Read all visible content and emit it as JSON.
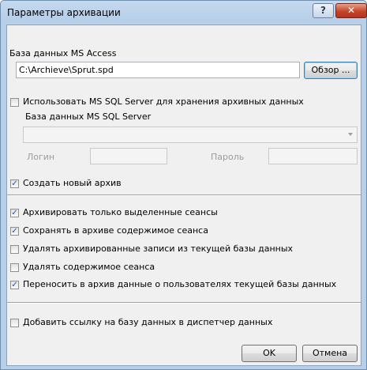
{
  "window": {
    "title": "Параметры архивации",
    "help_label": "?",
    "close_label": "✕"
  },
  "access": {
    "label": "База данных MS Access",
    "path": "C:\\Archieve\\Sprut.spd",
    "browse_label": "Обзор ..."
  },
  "sql": {
    "use_label": "Использовать MS SQL Server для хранения архивных данных",
    "use_checked": false,
    "db_label": "База данных MS SQL Server",
    "db_value": "",
    "login_label": "Логин",
    "login_value": "",
    "password_label": "Пароль",
    "password_value": ""
  },
  "options": [
    {
      "label": "Создать новый архив",
      "checked": true
    },
    {
      "label": "Архивировать только выделенные сеансы",
      "checked": true
    },
    {
      "label": "Сохранять в архиве содержимое сеанса",
      "checked": true
    },
    {
      "label": "Удалять архивированные записи из текущей базы данных",
      "checked": false
    },
    {
      "label": "Удалять содержимое сеанса",
      "checked": false
    },
    {
      "label": "Переносить в архив данные о пользователях текущей базы данных",
      "checked": true
    },
    {
      "label": "Добавить ссылку на базу данных в диспетчер данных",
      "checked": false
    }
  ],
  "buttons": {
    "ok_label": "OK",
    "cancel_label": "Отмена"
  }
}
